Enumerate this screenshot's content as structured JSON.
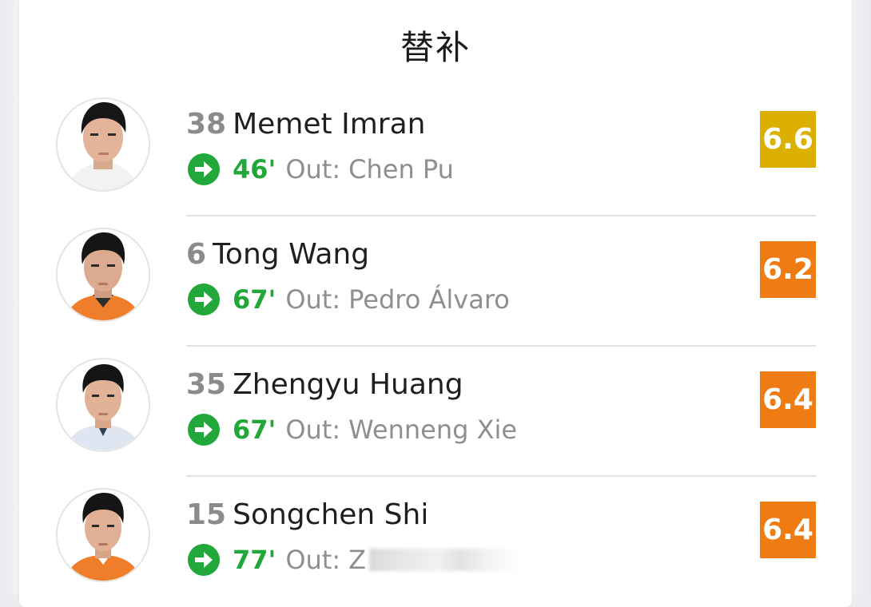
{
  "title": "替补",
  "colors": {
    "sub_green": "#22a83a",
    "rating_yellow": "#dcb000",
    "rating_orange": "#ee7c12"
  },
  "players": [
    {
      "number": "38",
      "name": "Memet Imran",
      "minute": "46'",
      "out_label": "Out:",
      "out_player": "Chen Pu",
      "rating": "6.6",
      "rating_color": "#dcb000",
      "icon": "substitution-in-arrow-icon"
    },
    {
      "number": "6",
      "name": "Tong Wang",
      "minute": "67'",
      "out_label": "Out:",
      "out_player": "Pedro Álvaro",
      "rating": "6.2",
      "rating_color": "#ee7c12",
      "icon": "substitution-in-arrow-icon"
    },
    {
      "number": "35",
      "name": "Zhengyu Huang",
      "minute": "67'",
      "out_label": "Out:",
      "out_player": "Wenneng Xie",
      "rating": "6.4",
      "rating_color": "#ee7c12",
      "icon": "substitution-in-arrow-icon"
    },
    {
      "number": "15",
      "name": "Songchen Shi",
      "minute": "77'",
      "out_label": "Out:",
      "out_player": "Z",
      "rating": "6.4",
      "rating_color": "#ee7c12",
      "icon": "substitution-in-arrow-icon"
    }
  ]
}
